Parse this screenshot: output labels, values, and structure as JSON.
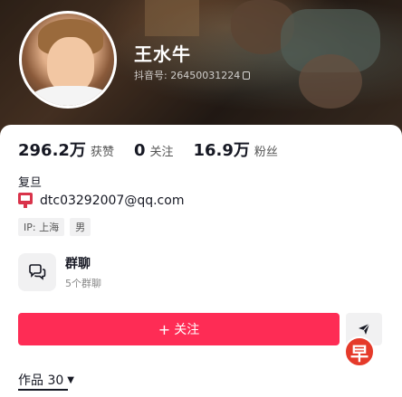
{
  "profile": {
    "username": "王水牛",
    "account_id": "抖音号: 26450031224"
  },
  "stats": {
    "likes_value": "296.2万",
    "likes_label": "获赞",
    "following_value": "0",
    "following_label": "关注",
    "followers_value": "16.9万",
    "followers_label": "粉丝"
  },
  "bio": {
    "school": "复旦",
    "email": "dtc03292007@qq.com"
  },
  "tags": [
    "IP: 上海",
    "男"
  ],
  "group_chat": {
    "title": "群聊",
    "subtitle": "5个群聊"
  },
  "actions": {
    "follow_label": "关注",
    "follow_plus": "+"
  },
  "works": {
    "label": "作品 30",
    "caret": "▼"
  },
  "watermark": {
    "text": "早"
  },
  "colors": {
    "accent": "#fe2c55",
    "text": "#161823",
    "muted": "#888888",
    "tag_bg": "#f1f1f2"
  }
}
